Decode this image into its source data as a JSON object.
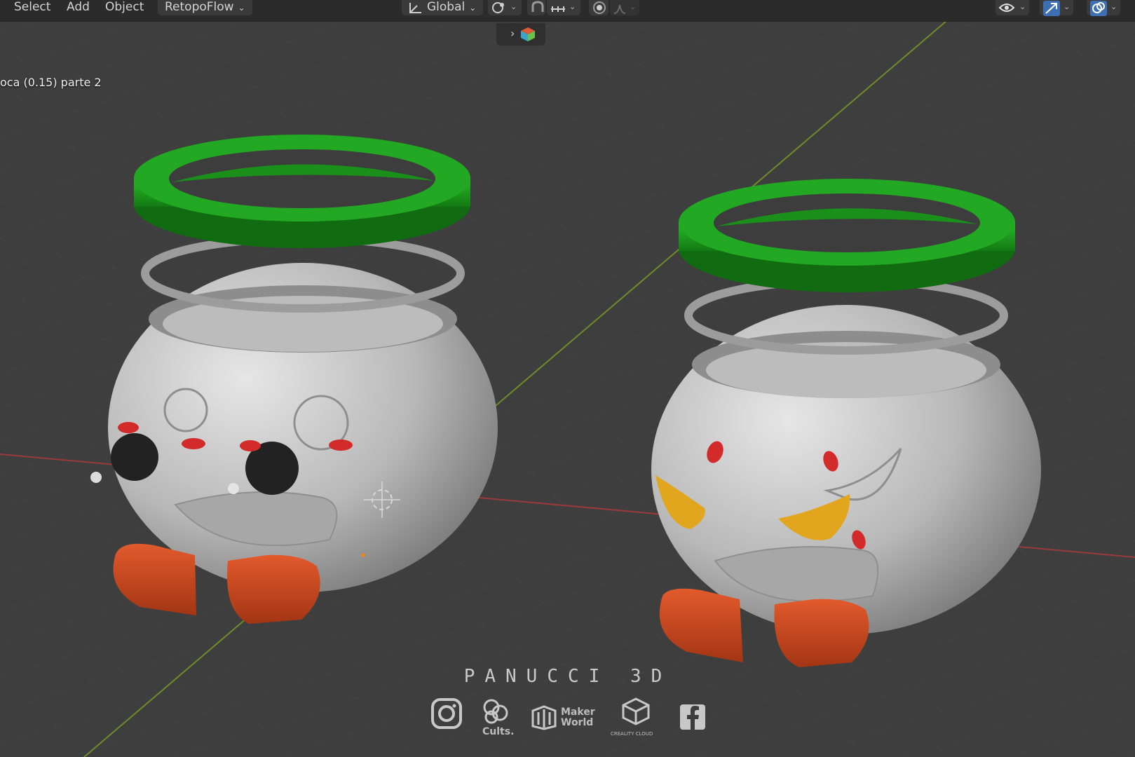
{
  "menu": {
    "select": "Select",
    "add": "Add",
    "object": "Object",
    "retopo": "RetopoFlow"
  },
  "toolbar": {
    "orientation": "Global",
    "icons": [
      "transform-orientation-icon",
      "pivot-point-icon",
      "snap-icon",
      "snap-target-icon",
      "proportional-edit-icon",
      "falloff-icon",
      "visibility-icon",
      "gizmo-icon",
      "overlay-icon"
    ]
  },
  "viewport": {
    "object_info": "oca (0.15) parte 2"
  },
  "colors": {
    "header_bg": "#2b2b2b",
    "viewport_bg": "#3d3d3d",
    "lid_green": "#1f9a1f",
    "pot_gray": "#b9b9b9",
    "feet_orange": "#c7471f",
    "eye_red": "#d32a2a",
    "brow_yellow": "#e2a51e",
    "x_axis": "#9a3a3a",
    "y_axis": "#6e8c2a"
  },
  "watermark": {
    "brand": "PANUCCI 3D",
    "cults": "Cults.",
    "maker_line1": "Maker",
    "maker_line2": "World",
    "creality": "CREALITY CLOUD"
  }
}
